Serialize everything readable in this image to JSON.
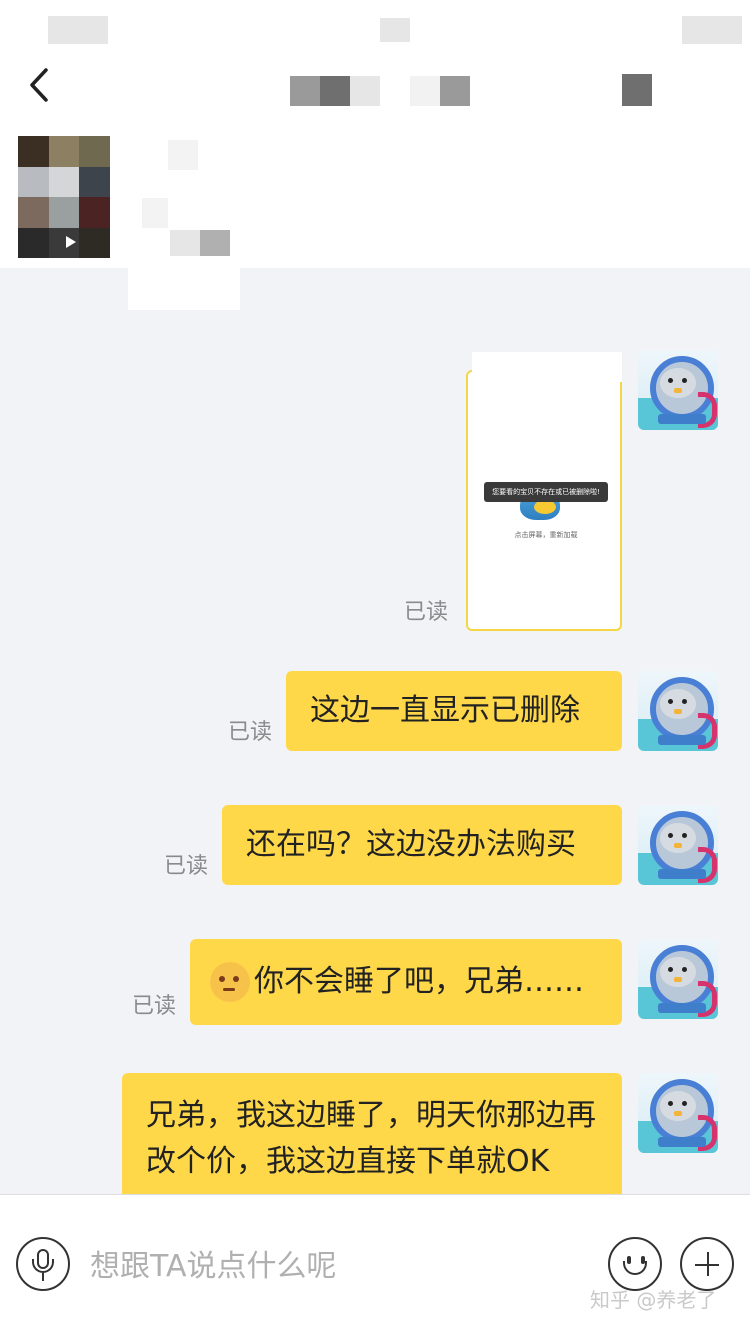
{
  "image_message": {
    "toast_text": "您要看的宝贝不存在或已被删除啦!",
    "reload_text": "点击屏幕，重新加载",
    "read_label": "已读"
  },
  "messages": [
    {
      "text": "这边一直显示已删除",
      "read_label": "已读"
    },
    {
      "text": "还在吗？这边没办法购买",
      "read_label": "已读"
    },
    {
      "emoji": "sweat-face-emoji",
      "text": "你不会睡了吧，兄弟……",
      "read_label": "已读"
    },
    {
      "text": "兄弟，我这边睡了，明天你那边再改个价，我这边直接下单就OK"
    }
  ],
  "input": {
    "placeholder": "想跟TA说点什么呢"
  },
  "icons": {
    "back": "chevron-left-icon",
    "mic": "microphone-icon",
    "emoji": "smiley-icon",
    "plus": "plus-icon"
  },
  "watermark": "知乎 @养老了",
  "colors": {
    "bubble": "#ffd84a",
    "background": "#f2f3f6",
    "read_label": "#8a8a8a"
  }
}
